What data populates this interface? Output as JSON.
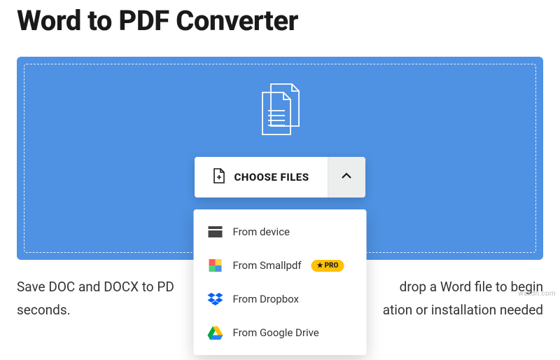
{
  "title": "Word to PDF Converter",
  "chooser": {
    "label": "CHOOSE FILES"
  },
  "menu": {
    "device": "From device",
    "smallpdf": "From Smallpdf",
    "dropbox": "From Dropbox",
    "gdrive": "From Google Drive",
    "pro_badge": "PRO"
  },
  "description": {
    "line1_left": "Save DOC and DOCX to PD",
    "line1_right": "drop a Word file to begin",
    "line2_left": "seconds.",
    "line2_right": "ation or installation needed"
  },
  "watermark": "wsxdn.com"
}
